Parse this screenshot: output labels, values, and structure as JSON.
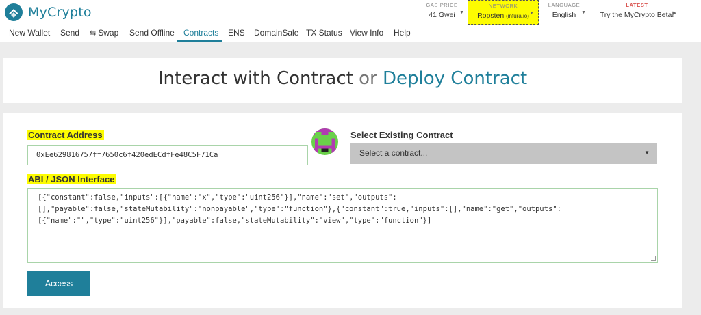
{
  "app": {
    "title": "MyCrypto"
  },
  "header": {
    "gas_label": "GAS PRICE",
    "gas_value": "41 Gwei",
    "network_label": "NETWORK",
    "network_value": "Ropsten",
    "network_sub": "(infura.io)",
    "language_label": "LANGUAGE",
    "language_value": "English",
    "latest_label": "LATEST",
    "latest_value": "Try the MyCrypto Beta!"
  },
  "nav": {
    "items": [
      "New Wallet",
      "Send",
      "Swap",
      "Send Offline",
      "Contracts",
      "ENS",
      "DomainSale",
      "TX Status",
      "View Info",
      "Help"
    ],
    "active": "Contracts"
  },
  "page": {
    "title_main": "Interact with Contract",
    "title_or": "or",
    "title_alt": "Deploy Contract"
  },
  "form": {
    "contract_address_label": "Contract Address",
    "contract_address_value": "0xEe629816757ff7650c6f420edECdfFe48C5F71Ca",
    "select_label": "Select Existing Contract",
    "select_value": "Select a contract...",
    "abi_label": "ABI / JSON Interface",
    "abi_lines": [
      "[{\"constant\":false,\"inputs\":[{\"name\":\"x\",\"type\":\"uint256\"}],\"name\":\"set\",\"outputs\":",
      "[],\"payable\":false,\"stateMutability\":\"nonpayable\",\"type\":\"function\"},{\"constant\":true,\"inputs\":[],\"name\":\"get\",\"outputs\":",
      "[{\"name\":\"\",\"type\":\"uint256\"}],\"payable\":false,\"stateMutability\":\"view\",\"type\":\"function\"}]"
    ],
    "access_button": "Access"
  },
  "colors": {
    "brand": "#1f7f9a",
    "highlight": "#fdfc01",
    "select_bg": "#c4c4c4"
  },
  "icons": {
    "logo": "mycrypto-logo-icon",
    "swap": "swap-icon",
    "avatar": "identicon-avatar"
  }
}
